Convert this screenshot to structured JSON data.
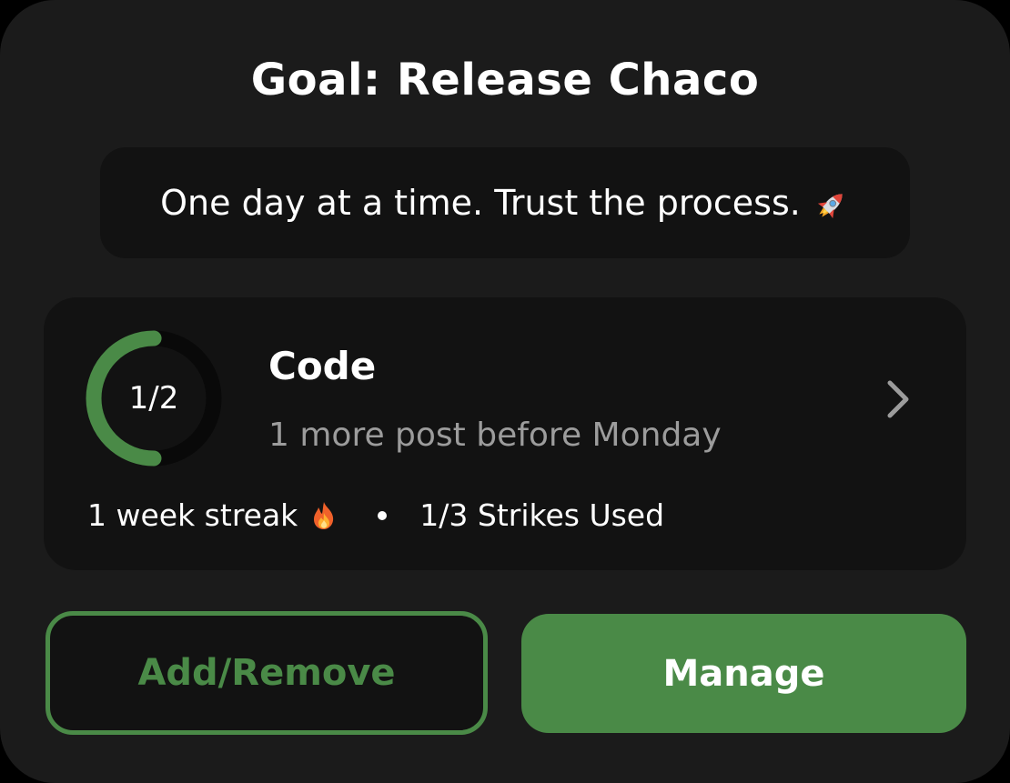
{
  "goal": {
    "title": "Goal: Release Chaco",
    "quote": "One day at a time. Trust the process.",
    "quote_icon": "rocket-icon"
  },
  "habit": {
    "name": "Code",
    "progress_label": "1/2",
    "progress_fraction": 0.5,
    "subtitle": "1 more post before Monday",
    "streak_text": "1 week streak",
    "streak_icon": "fire-icon",
    "strikes_text": "1/3 Strikes Used"
  },
  "buttons": {
    "add_remove": "Add/Remove",
    "manage": "Manage"
  },
  "colors": {
    "accent": "#4a8a47",
    "background": "#1b1b1b",
    "panel": "#121212"
  }
}
